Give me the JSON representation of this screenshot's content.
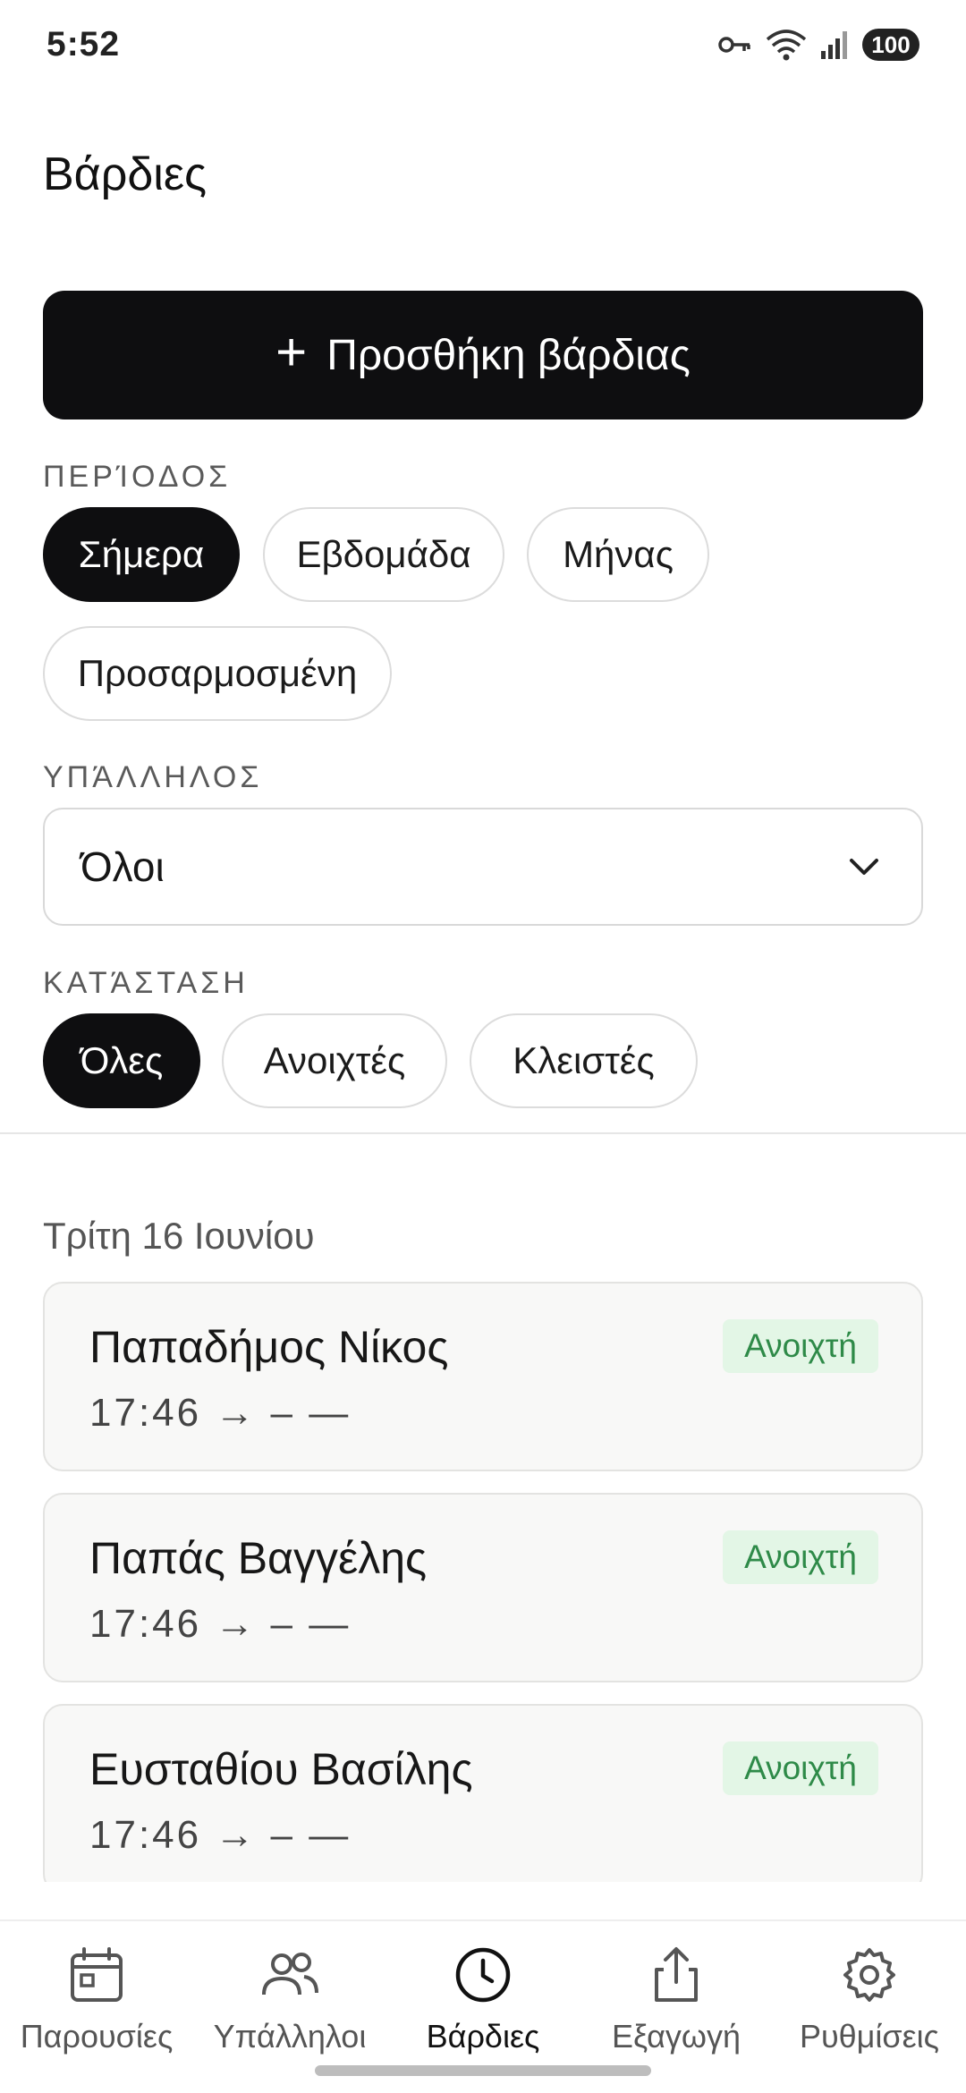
{
  "status_bar": {
    "time": "5:52",
    "battery": "100"
  },
  "header": {
    "title": "Βάρδιες"
  },
  "add_button": {
    "label": "Προσθήκη βάρδιας"
  },
  "period": {
    "label": "ΠΕΡΊΟΔΟΣ",
    "options": [
      "Σήμερα",
      "Εβδομάδα",
      "Μήνας",
      "Προσαρμοσμένη"
    ],
    "selected": "Σήμερα"
  },
  "employee": {
    "label": "ΥΠΆΛΛΗΛΟΣ",
    "value": "Όλοι"
  },
  "status": {
    "label": "ΚΑΤΆΣΤΑΣΗ",
    "options": [
      "Όλες",
      "Ανοιχτές",
      "Κλειστές"
    ],
    "selected": "Όλες"
  },
  "shifts": {
    "date": "Τρίτη 16 Ιουνίου",
    "items": [
      {
        "name": "Παπαδήμος Νίκος",
        "time": "17:46 → –  —",
        "status": "Ανοιχτή"
      },
      {
        "name": "Παπάς Βαγγέλης",
        "time": "17:46 → –  —",
        "status": "Ανοιχτή"
      },
      {
        "name": "Ευσταθίου Βασίλης",
        "time": "17:46 → –  —",
        "status": "Ανοιχτή"
      }
    ]
  },
  "nav": {
    "items": [
      {
        "label": "Παρουσίες",
        "icon": "calendar-icon"
      },
      {
        "label": "Υπάλληλοι",
        "icon": "users-icon"
      },
      {
        "label": "Βάρδιες",
        "icon": "clock-icon"
      },
      {
        "label": "Εξαγωγή",
        "icon": "share-icon"
      },
      {
        "label": "Ρυθμίσεις",
        "icon": "gear-icon"
      }
    ],
    "active": "Βάρδιες"
  },
  "colors": {
    "primary": "#0e0e10",
    "badge_bg": "#e3f6e6",
    "badge_text": "#2e8a48"
  }
}
